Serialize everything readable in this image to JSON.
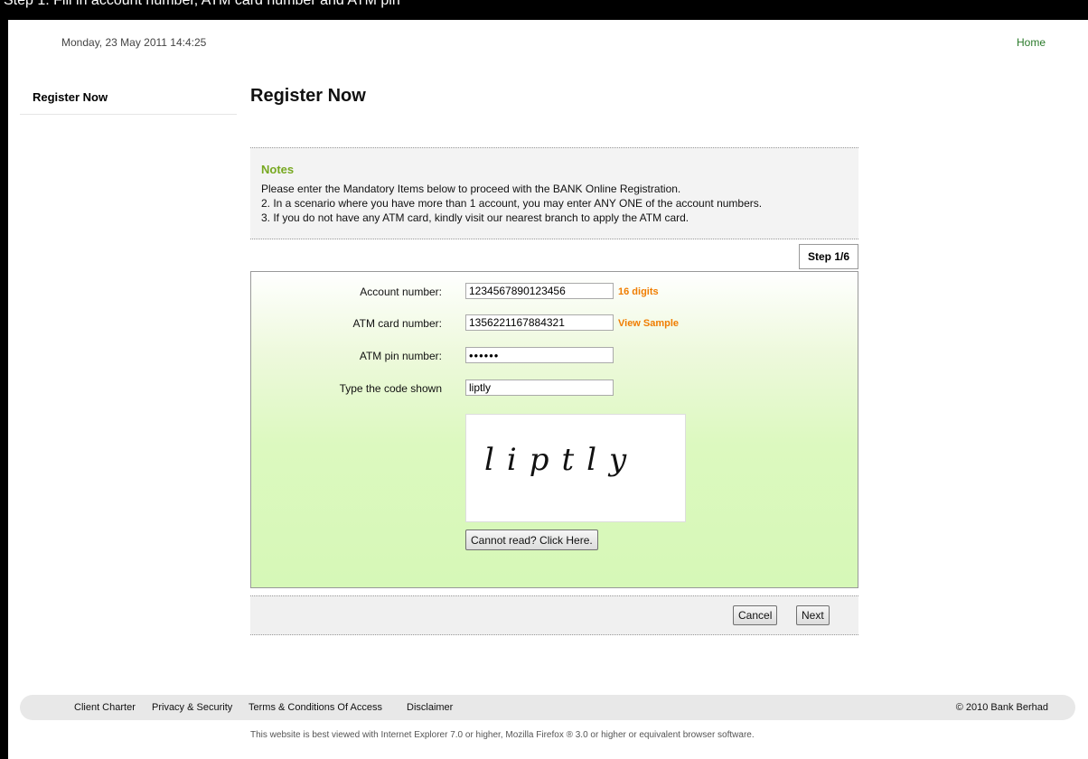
{
  "browser_bar": {
    "text": "Step 1: Fill in account number, ATM card number and ATM pin"
  },
  "header": {
    "datetime": "Monday, 23 May 2011 14:4:25",
    "home_link": "Home"
  },
  "sidebar": {
    "items": [
      {
        "label": "Register Now"
      }
    ]
  },
  "main": {
    "title": "Register Now",
    "notes": {
      "title": "Notes",
      "lines": [
        "Please enter the Mandatory Items below to proceed with the BANK Online Registration.",
        "2. In a scenario where you have more than 1 account, you may enter ANY ONE of the account numbers.",
        "3. If you do not have any ATM card, kindly visit our nearest branch to apply the ATM card."
      ]
    },
    "step": "Step 1/6",
    "form": {
      "account_label": "Account number:",
      "account_value": "1234567890123456",
      "account_hint": "16 digits",
      "atm_label": "ATM card number:",
      "atm_value": "1356221167884321",
      "atm_hint": "View Sample",
      "pin_label": "ATM pin number:",
      "pin_value": "••••••",
      "code_label": "Type the code shown",
      "code_value": "liptly",
      "captcha_text": "liptly",
      "cannot_read_label": "Cannot read? Click Here."
    },
    "actions": {
      "cancel": "Cancel",
      "next": "Next"
    }
  },
  "footer": {
    "links": [
      "Client Charter",
      "Privacy & Security",
      "Terms & Conditions Of Access",
      "Disclaimer"
    ],
    "copyright": "© 2010 Bank Berhad",
    "browser_note": "This website is best viewed with Internet Explorer 7.0 or higher, Mozilla Firefox ® 3.0 or higher or equivalent browser software."
  }
}
